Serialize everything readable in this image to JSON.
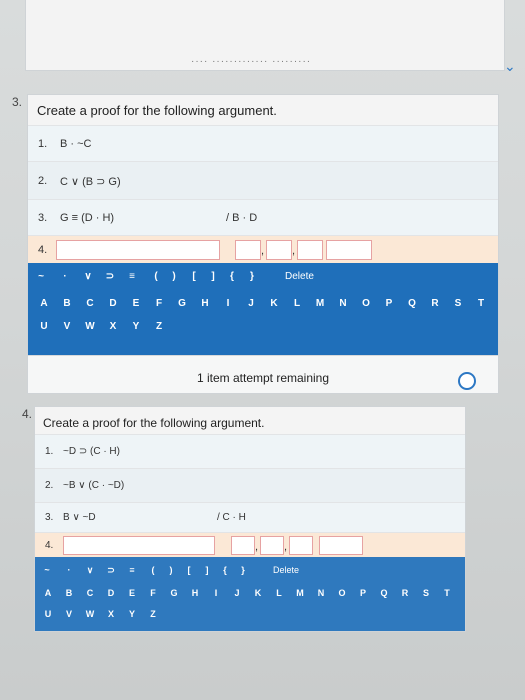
{
  "header": {
    "partial_text": "···· ············· ·········"
  },
  "q3": {
    "number": "3.",
    "title": "Create a proof for the following argument.",
    "lines": [
      {
        "n": "1.",
        "expr": "B · ~C"
      },
      {
        "n": "2.",
        "expr": "C ∨ (B ⊃ G)"
      },
      {
        "n": "3.",
        "expr": "G ≡ (D · H)"
      }
    ],
    "conclusion": "/ B · D",
    "input_line": "4.",
    "keys_row1": [
      "~",
      "·",
      "∨",
      "⊃",
      "≡",
      "(",
      ")",
      "[",
      "]",
      "{",
      "}"
    ],
    "delete_label": "Delete",
    "keys_row2": [
      "A",
      "B",
      "C",
      "D",
      "E",
      "F",
      "G",
      "H",
      "I",
      "J",
      "K",
      "L",
      "M",
      "N",
      "O",
      "P",
      "Q",
      "R",
      "S",
      "T"
    ],
    "keys_row3": [
      "U",
      "V",
      "W",
      "X",
      "Y",
      "Z"
    ],
    "status": "1 item attempt remaining"
  },
  "q4": {
    "number": "4.",
    "title": "Create a proof for the following argument.",
    "lines": [
      {
        "n": "1.",
        "expr": "~D ⊃ (C · H)"
      },
      {
        "n": "2.",
        "expr": "~B ∨ (C · ~D)"
      },
      {
        "n": "3.",
        "expr": "B ∨ ~D"
      }
    ],
    "conclusion": "/ C · H",
    "input_line": "4.",
    "keys_row1": [
      "~",
      "·",
      "∨",
      "⊃",
      "≡",
      "(",
      ")",
      "[",
      "]",
      "{",
      "}"
    ],
    "delete_label": "Delete",
    "keys_row2": [
      "A",
      "B",
      "C",
      "D",
      "E",
      "F",
      "G",
      "H",
      "I",
      "J",
      "K",
      "L",
      "M",
      "N",
      "O",
      "P",
      "Q",
      "R",
      "S",
      "T"
    ],
    "keys_row3": [
      "U",
      "V",
      "W",
      "X",
      "Y",
      "Z"
    ]
  },
  "colors": {
    "keyboard": "#1f6fba",
    "accent": "#2d78c4",
    "input_row": "#fbe8d6"
  }
}
